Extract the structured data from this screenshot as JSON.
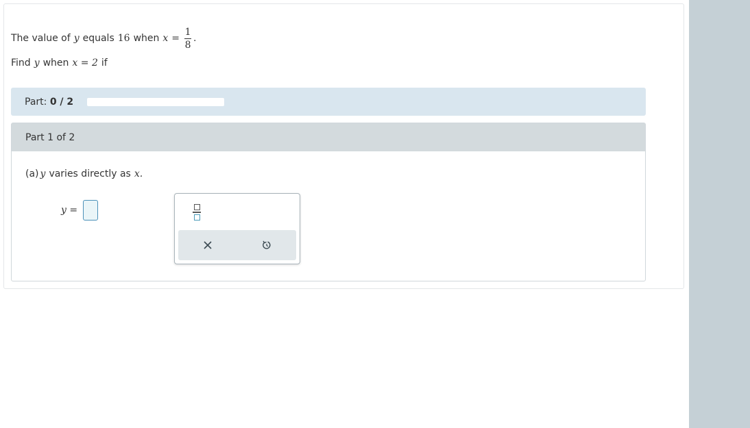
{
  "question": {
    "line1_prefix": "The value of",
    "var_y": "y",
    "equals_text": "equals",
    "value_16": "16",
    "when_text": "when",
    "var_x": "x",
    "eq_sign": "=",
    "frac_num": "1",
    "frac_den": "8",
    "period": ".",
    "line2_find": "Find",
    "line2_when": "when",
    "line2_x_eq": "x = 2",
    "line2_if": "if"
  },
  "progress": {
    "label": "Part:",
    "value": "0 / 2",
    "fraction": 0
  },
  "part": {
    "header": "Part 1 of 2",
    "sub_label": "(a)",
    "sub_var": "y",
    "sub_text": "varies directly as",
    "sub_x": "x.",
    "eq_label": "y =",
    "input_value": ""
  },
  "palette": {
    "tools": [
      "fraction-icon"
    ],
    "actions": [
      "clear-icon",
      "undo-icon"
    ]
  },
  "colors": {
    "progress_bg": "#d9e6ef",
    "part_header_bg": "#d3dadd",
    "side_panel": "#c5d0d6",
    "accent": "#4a90b8"
  }
}
